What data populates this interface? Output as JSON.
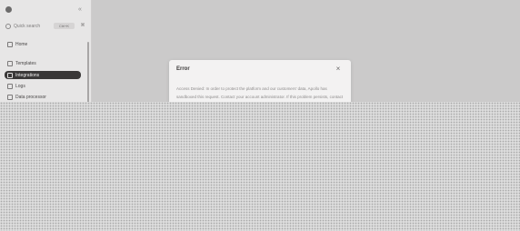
{
  "sidebar": {
    "search": {
      "label": "Quick search",
      "shortcut": "Ctrl+K"
    },
    "nav": [
      {
        "label": "Home",
        "icon": "home-icon",
        "active": false
      },
      {
        "label": "Templates",
        "icon": "templates-icon",
        "active": false
      },
      {
        "label": "Integrations",
        "icon": "integrations-icon",
        "active": true
      },
      {
        "label": "Logs",
        "icon": "logs-icon",
        "active": false
      },
      {
        "label": "Data processor",
        "icon": "data-processor-icon",
        "active": false
      }
    ]
  },
  "modal": {
    "title": "Error",
    "close_label": "×",
    "body": "Access Denied: In order to protect the platform and our customers' data, Apollo has sandboxed this request. Contact your account administrator. If this problem persists, contact support."
  },
  "colors": {
    "active_nav_bg": "#3a3838",
    "overlay": "#cbcaca",
    "modal_bg": "#f3f2f2"
  }
}
